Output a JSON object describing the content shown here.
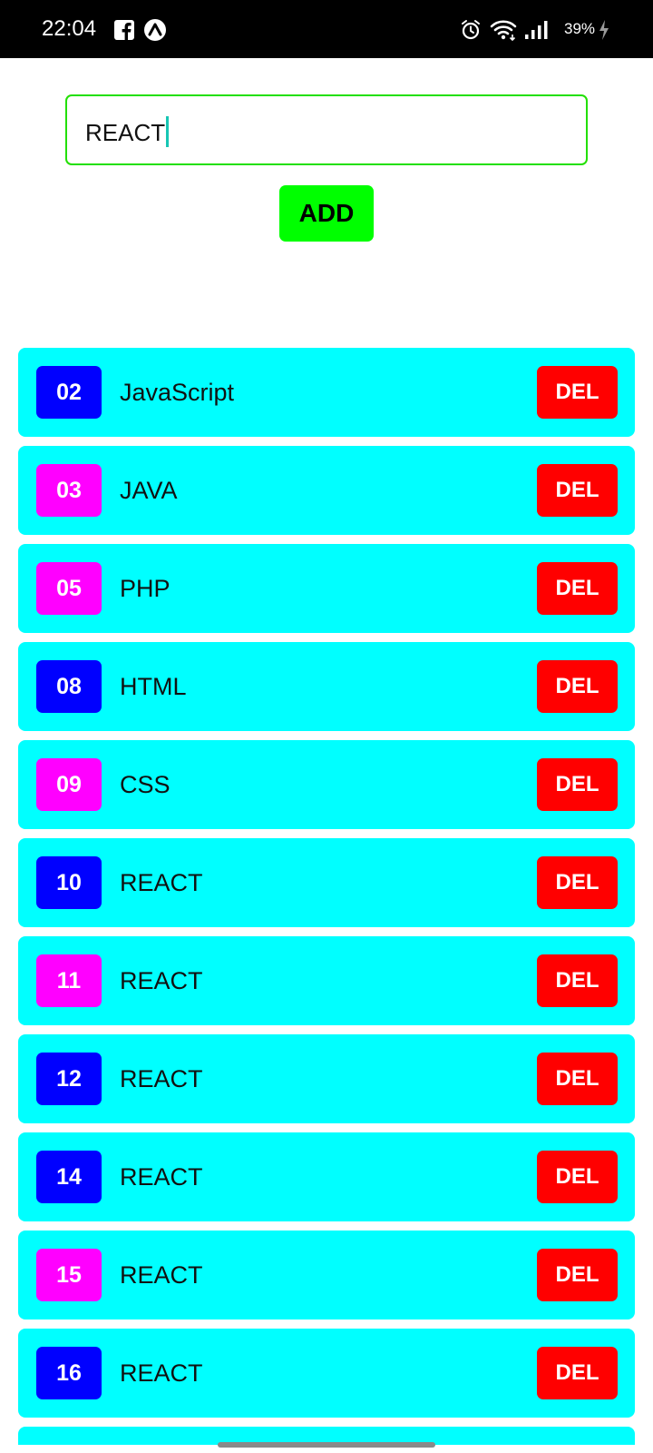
{
  "status_bar": {
    "time": "22:04",
    "battery": "39%",
    "left_icons": [
      "facebook-icon",
      "app-notification-icon"
    ],
    "right_icons": [
      "alarm-icon",
      "wifi-icon",
      "signal-icon",
      "charging-icon"
    ]
  },
  "input": {
    "value": "REACT",
    "border_color": "#22e000"
  },
  "add_button": {
    "label": "ADD",
    "color": "#00ff00"
  },
  "colors": {
    "item_background": "#00ffff",
    "badge_blue": "#0000ff",
    "badge_magenta": "#ff00ff",
    "delete": "#ff0000"
  },
  "items": [
    {
      "number": "02",
      "label": "JavaScript",
      "badge_color": "#0000ff",
      "delete_label": "DEL"
    },
    {
      "number": "03",
      "label": "JAVA",
      "badge_color": "#ff00ff",
      "delete_label": "DEL"
    },
    {
      "number": "05",
      "label": "PHP",
      "badge_color": "#ff00ff",
      "delete_label": "DEL"
    },
    {
      "number": "08",
      "label": "HTML",
      "badge_color": "#0000ff",
      "delete_label": "DEL"
    },
    {
      "number": "09",
      "label": "CSS",
      "badge_color": "#ff00ff",
      "delete_label": "DEL"
    },
    {
      "number": "10",
      "label": "REACT",
      "badge_color": "#0000ff",
      "delete_label": "DEL"
    },
    {
      "number": "11",
      "label": "REACT",
      "badge_color": "#ff00ff",
      "delete_label": "DEL"
    },
    {
      "number": "12",
      "label": "REACT",
      "badge_color": "#0000ff",
      "delete_label": "DEL"
    },
    {
      "number": "14",
      "label": "REACT",
      "badge_color": "#0000ff",
      "delete_label": "DEL"
    },
    {
      "number": "15",
      "label": "REACT",
      "badge_color": "#ff00ff",
      "delete_label": "DEL"
    },
    {
      "number": "16",
      "label": "REACT",
      "badge_color": "#0000ff",
      "delete_label": "DEL"
    }
  ]
}
